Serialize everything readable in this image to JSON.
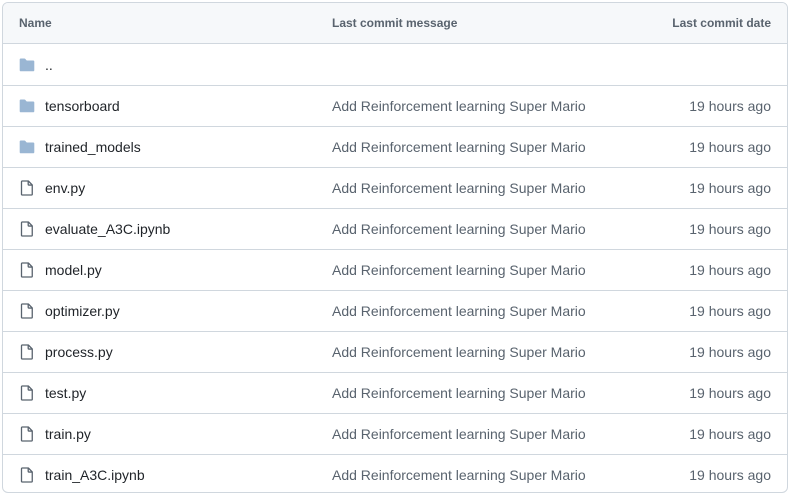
{
  "header": {
    "name_label": "Name",
    "message_label": "Last commit message",
    "date_label": "Last commit date"
  },
  "parent": {
    "label": "..",
    "icon": "folder-icon"
  },
  "rows": [
    {
      "name": "tensorboard",
      "type": "folder",
      "icon": "folder-icon",
      "message": "Add Reinforcement learning Super Mario",
      "date": "19 hours ago"
    },
    {
      "name": "trained_models",
      "type": "folder",
      "icon": "folder-icon",
      "message": "Add Reinforcement learning Super Mario",
      "date": "19 hours ago"
    },
    {
      "name": "env.py",
      "type": "file",
      "icon": "file-icon",
      "message": "Add Reinforcement learning Super Mario",
      "date": "19 hours ago"
    },
    {
      "name": "evaluate_A3C.ipynb",
      "type": "file",
      "icon": "file-icon",
      "message": "Add Reinforcement learning Super Mario",
      "date": "19 hours ago"
    },
    {
      "name": "model.py",
      "type": "file",
      "icon": "file-icon",
      "message": "Add Reinforcement learning Super Mario",
      "date": "19 hours ago"
    },
    {
      "name": "optimizer.py",
      "type": "file",
      "icon": "file-icon",
      "message": "Add Reinforcement learning Super Mario",
      "date": "19 hours ago"
    },
    {
      "name": "process.py",
      "type": "file",
      "icon": "file-icon",
      "message": "Add Reinforcement learning Super Mario",
      "date": "19 hours ago"
    },
    {
      "name": "test.py",
      "type": "file",
      "icon": "file-icon",
      "message": "Add Reinforcement learning Super Mario",
      "date": "19 hours ago"
    },
    {
      "name": "train.py",
      "type": "file",
      "icon": "file-icon",
      "message": "Add Reinforcement learning Super Mario",
      "date": "19 hours ago"
    },
    {
      "name": "train_A3C.ipynb",
      "type": "file",
      "icon": "file-icon",
      "message": "Add Reinforcement learning Super Mario",
      "date": "19 hours ago"
    }
  ],
  "colors": {
    "folder": "#9ab6d3",
    "file_stroke": "#59636e",
    "border": "#d0d7de",
    "header_bg": "#f6f8fa"
  }
}
